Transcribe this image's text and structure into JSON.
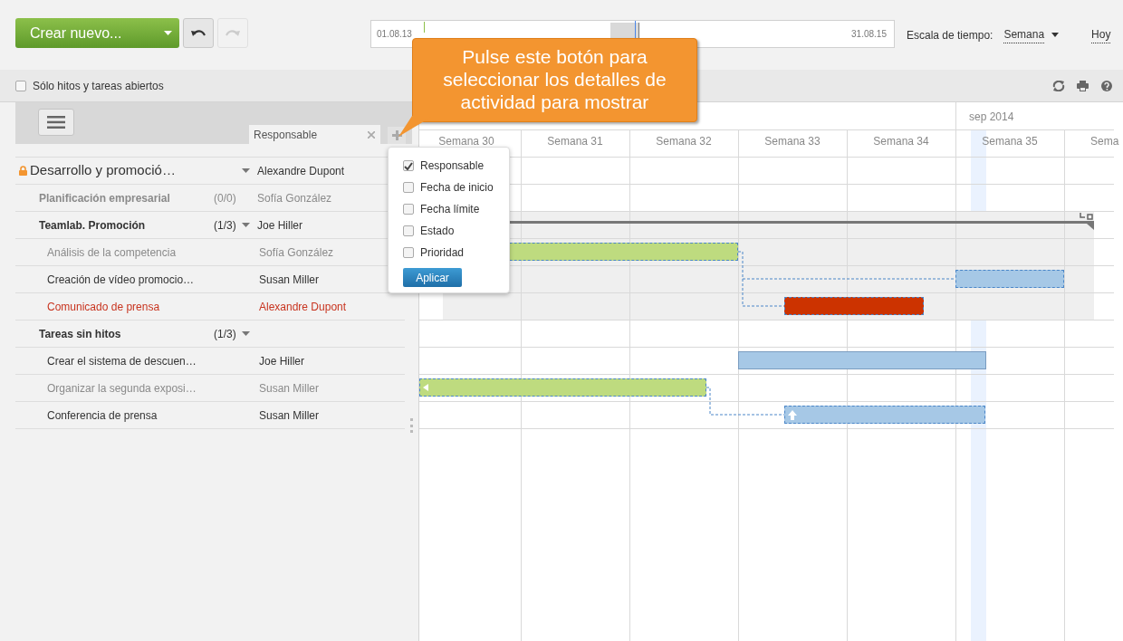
{
  "toolbar": {
    "create_button": "Crear nuevo...",
    "range_start": "01.08.13",
    "range_end": "31.08.15",
    "scale_label": "Escala de tiempo:",
    "scale_value": "Semana",
    "today_link": "Hoy"
  },
  "filter": {
    "label": "Sólo hitos y tareas abiertos",
    "checked": false
  },
  "columns": [
    {
      "label": "Responsable"
    }
  ],
  "column_menu": {
    "options": [
      {
        "label": "Responsable",
        "checked": true
      },
      {
        "label": "Fecha de inicio",
        "checked": false
      },
      {
        "label": "Fecha límite",
        "checked": false
      },
      {
        "label": "Estado",
        "checked": false
      },
      {
        "label": "Prioridad",
        "checked": false
      }
    ],
    "apply": "Aplicar"
  },
  "tooltip": "Pulse este botón para seleccionar los detalles de actividad para mostrar",
  "timeline": {
    "month": "sep 2014",
    "weeks": [
      "Semana 30",
      "Semana 31",
      "Semana 32",
      "Semana 33",
      "Semana 34",
      "Semana 35",
      "Sema"
    ]
  },
  "rows": [
    {
      "kind": "project",
      "title": "Desarrollo y promoció…",
      "responsible": "Alexandre Dupont",
      "locked": true,
      "expanded": true
    },
    {
      "kind": "milestone",
      "title": "Planificación empresarial",
      "count": "(0/0)",
      "responsible": "Sofía González",
      "closed": true,
      "expanded": false
    },
    {
      "kind": "milestone",
      "title": "Teamlab. Promoción",
      "count": "(1/3)",
      "responsible": "Joe Hiller",
      "closed": false,
      "expanded": true
    },
    {
      "kind": "task",
      "title": "Análisis de la competencia",
      "responsible": "Sofía González",
      "closed": true,
      "overdue": false
    },
    {
      "kind": "task",
      "title": "Creación de vídeo promocio…",
      "responsible": "Susan Miller",
      "closed": false,
      "overdue": false
    },
    {
      "kind": "task",
      "title": "Comunicado de prensa",
      "responsible": "Alexandre Dupont",
      "closed": false,
      "overdue": true
    },
    {
      "kind": "milestone",
      "title": "Tareas sin hitos",
      "count": "(1/3)",
      "closed": false,
      "expanded": true
    },
    {
      "kind": "task",
      "title": "Crear el sistema de descuen…",
      "responsible": "Joe Hiller",
      "closed": false,
      "overdue": false
    },
    {
      "kind": "task",
      "title": "Organizar la segunda exposi…",
      "responsible": "Susan Miller",
      "closed": true,
      "overdue": false
    },
    {
      "kind": "task",
      "title": "Conferencia de prensa",
      "responsible": "Susan Miller",
      "closed": false,
      "overdue": false
    }
  ]
}
